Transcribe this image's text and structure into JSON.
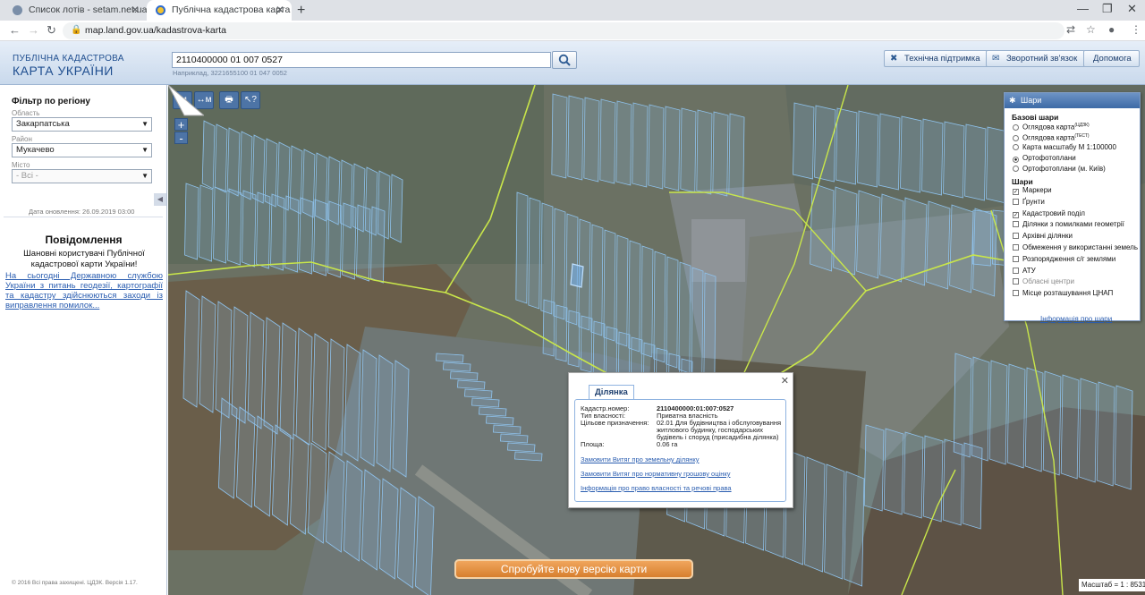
{
  "browser": {
    "tabs": [
      {
        "title": "Список лотів - setam.net.ua",
        "active": false
      },
      {
        "title": "Публічна кадастрова карта Укр",
        "active": true
      }
    ],
    "url": "map.land.gov.ua/kadastrova-karta"
  },
  "header": {
    "logo_top": "ПУБЛІЧНА КАДАСТРОВА",
    "logo_bottom": "КАРТА УКРАЇНИ",
    "search_value": "2110400000 01 007 0527",
    "search_hint": "Наприклад, 3221655100 01 047 0052",
    "buttons": {
      "support": "Технічна підтримка",
      "feedback": "Зворотний зв'язок",
      "help": "Допомога"
    }
  },
  "filter": {
    "title": "Фільтр по регіону",
    "region_label": "Область",
    "region_value": "Закарпатська",
    "district_label": "Район",
    "district_value": "Мукачево",
    "city_label": "Місто",
    "city_value": "- Всі -",
    "update_date": "Дата оновлення: 26.09.2019 03:00"
  },
  "message": {
    "title": "Повідомлення",
    "body": "Шановні користувачі Публічної кадастрової карти України!",
    "link": "На сьогодні Державною службою України з питань геодезії, картографії та кадастру здійснюються заходи із виправлення помилок..."
  },
  "footer": {
    "copyright": "© 2016 Всі права захищені. ЦДЗК. Версія 1.17."
  },
  "map": {
    "tools": [
      "Iм",
      "↔м",
      "🖶",
      "↖?"
    ],
    "zoom_in": "+",
    "zoom_out": "-",
    "new_version": "Спробуйте нову версію карти",
    "scale": "Масштаб = 1 : 8531"
  },
  "layers": {
    "title": "Шари",
    "base_title": "Базові шари",
    "base": [
      {
        "label": "Оглядова карта",
        "sup": "(ЦДЗК)",
        "checked": false
      },
      {
        "label": "Оглядова карта",
        "sup": "(ТЕСТ)",
        "checked": false
      },
      {
        "label": "Карта масштабу М 1:100000",
        "sup": "",
        "checked": false
      },
      {
        "label": "Ортофотоплани",
        "sup": "",
        "checked": true
      },
      {
        "label": "Ортофотоплани (м. Київ)",
        "sup": "",
        "checked": false
      }
    ],
    "overlay_title": "Шари",
    "overlays": [
      {
        "label": "Маркери",
        "checked": true
      },
      {
        "label": "Ґрунти",
        "checked": false
      },
      {
        "label": "Кадастровий поділ",
        "checked": true
      },
      {
        "label": "Ділянки з помилками геометрії",
        "checked": false
      },
      {
        "label": "Архівні ділянки",
        "checked": false
      },
      {
        "label": "Обмеження у використанні земель",
        "checked": false
      },
      {
        "label": "Розпорядження с/г землями",
        "checked": false
      },
      {
        "label": "АТУ",
        "checked": false
      },
      {
        "label": "Обласні центри",
        "checked": false,
        "disabled": true
      },
      {
        "label": "Місце розташування ЦНАП",
        "checked": false
      }
    ],
    "info_link": "Інформація про шари"
  },
  "popup": {
    "tab": "Ділянка",
    "fields": [
      {
        "label": "Кадастр.номер:",
        "value": "2110400000:01:007:0527",
        "bold": true
      },
      {
        "label": "Тип власності:",
        "value": "Приватна власність"
      },
      {
        "label": "Цільове призначення:",
        "value": "02.01 Для будівництва і обслуговування житлового будинку, господарських будівель і споруд (присадибна ділянка)"
      },
      {
        "label": "Площа:",
        "value": "0.06 га"
      }
    ],
    "links": [
      "Замовити Витяг про земельну ділянку",
      "Замовити Витяг про нормативну грошову оцінку",
      "Інформація про право власності та речові права"
    ]
  },
  "colors": {
    "parcel_stroke": "#8fc3ee",
    "boundary": "#c9e64a",
    "header_blue": "#1f4e8f",
    "banner_orange": "#e08b37"
  }
}
